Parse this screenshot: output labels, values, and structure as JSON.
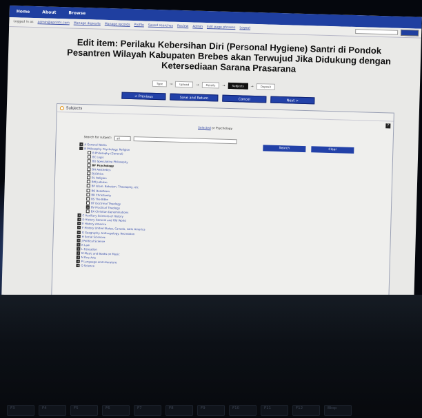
{
  "nav": {
    "items": [
      "Home",
      "About",
      "Browse"
    ]
  },
  "subnav": {
    "login_prefix": "Logged in as",
    "user": "admin@eprints.com",
    "links": [
      "Manage deposits",
      "Manage records",
      "Profile",
      "Saved searches",
      "Review",
      "Admin",
      "Edit page phrases",
      "Logout"
    ]
  },
  "page": {
    "title": "Edit item: Perilaku Kebersihan Diri (Personal Hygiene) Santri di Pondok Pesantren Wilayah Kabupaten Brebes akan Terwujud Jika Didukung dengan Ketersediaan Sarana Prasarana"
  },
  "workflow": {
    "steps": [
      "Type",
      "Upload",
      "Details",
      "Subjects",
      "Deposit"
    ],
    "active": "Subjects"
  },
  "actions": {
    "previous": "< Previous",
    "save_return": "Save and Return",
    "cancel": "Cancel",
    "next": "Next >"
  },
  "subjects_panel": {
    "heading": "Subjects",
    "help": "?",
    "breadcrumb_link": "Selected",
    "breadcrumb_rest": "or Psychology",
    "search_label": "Search for subject:",
    "search_scope": "all",
    "search_button": "Search",
    "clear_button": "Clear",
    "tree": [
      {
        "label": "A General Works",
        "box": "+",
        "indent": 0
      },
      {
        "label": "B Philosophy. Psychology. Religion",
        "box": "-",
        "indent": 0
      },
      {
        "label": "B Philosophy (General)",
        "box": "",
        "indent": 1
      },
      {
        "label": "BC Logic",
        "box": "",
        "indent": 1
      },
      {
        "label": "BD Speculative Philosophy",
        "box": "",
        "indent": 1
      },
      {
        "label": "BF Psychology",
        "box": "",
        "indent": 1,
        "bold": true
      },
      {
        "label": "BH Aesthetics",
        "box": "",
        "indent": 1
      },
      {
        "label": "BJ Ethics",
        "box": "",
        "indent": 1
      },
      {
        "label": "BL Religion",
        "box": "",
        "indent": 1
      },
      {
        "label": "BM Judaism",
        "box": "",
        "indent": 1
      },
      {
        "label": "BP Islam. Bahaism. Theosophy, etc",
        "box": "",
        "indent": 1
      },
      {
        "label": "BQ Buddhism",
        "box": "",
        "indent": 1
      },
      {
        "label": "BR Christianity",
        "box": "",
        "indent": 1
      },
      {
        "label": "BS The Bible",
        "box": "",
        "indent": 1
      },
      {
        "label": "BT Doctrinal Theology",
        "box": "",
        "indent": 1
      },
      {
        "label": "BV Practical Theology",
        "box": "+",
        "indent": 1
      },
      {
        "label": "BX Christian Denominations",
        "box": "",
        "indent": 1
      },
      {
        "label": "C Auxiliary Sciences of History",
        "box": "+",
        "indent": 0
      },
      {
        "label": "D History General and Old World",
        "box": "+",
        "indent": 0
      },
      {
        "label": "E History America",
        "box": "+",
        "indent": 0
      },
      {
        "label": "F History United States, Canada, Latin America",
        "box": "+",
        "indent": 0
      },
      {
        "label": "G Geography. Anthropology. Recreation",
        "box": "+",
        "indent": 0
      },
      {
        "label": "H Social Sciences",
        "box": "+",
        "indent": 0
      },
      {
        "label": "J Political Science",
        "box": "+",
        "indent": 0
      },
      {
        "label": "K Law",
        "box": "+",
        "indent": 0
      },
      {
        "label": "L Education",
        "box": "+",
        "indent": 0
      },
      {
        "label": "M Music and Books on Music",
        "box": "+",
        "indent": 0
      },
      {
        "label": "N Fine Arts",
        "box": "+",
        "indent": 0
      },
      {
        "label": "P Language and Literature",
        "box": "+",
        "indent": 0
      },
      {
        "label": "Q Science",
        "box": "+",
        "indent": 0
      }
    ]
  },
  "keyboard": {
    "keys": [
      "F3",
      "F4",
      "F5",
      "F6",
      "F7",
      "F8",
      "F9",
      "F10",
      "F11",
      "F12",
      "Bksp"
    ]
  },
  "colors": {
    "nav_bar": "#1f3fa0",
    "button": "#2241a8",
    "accent_orb": "#e08a00"
  }
}
